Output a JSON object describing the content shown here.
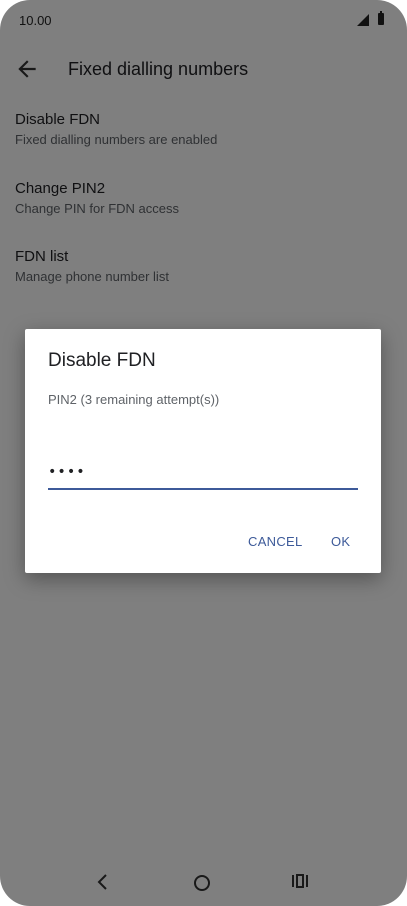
{
  "status_bar": {
    "time": "10.00"
  },
  "app_bar": {
    "title": "Fixed dialling numbers"
  },
  "settings_items": [
    {
      "title": "Disable FDN",
      "subtitle": "Fixed dialling numbers are enabled"
    },
    {
      "title": "Change PIN2",
      "subtitle": "Change PIN for FDN access"
    },
    {
      "title": "FDN list",
      "subtitle": "Manage phone number list"
    }
  ],
  "dialog": {
    "title": "Disable FDN",
    "message": "PIN2 (3 remaining attempt(s))",
    "pin_value": "••••",
    "cancel_label": "CANCEL",
    "ok_label": "OK"
  },
  "colors": {
    "accent": "#3d5a99",
    "scrim": "rgba(0,0,0,0.5)"
  }
}
